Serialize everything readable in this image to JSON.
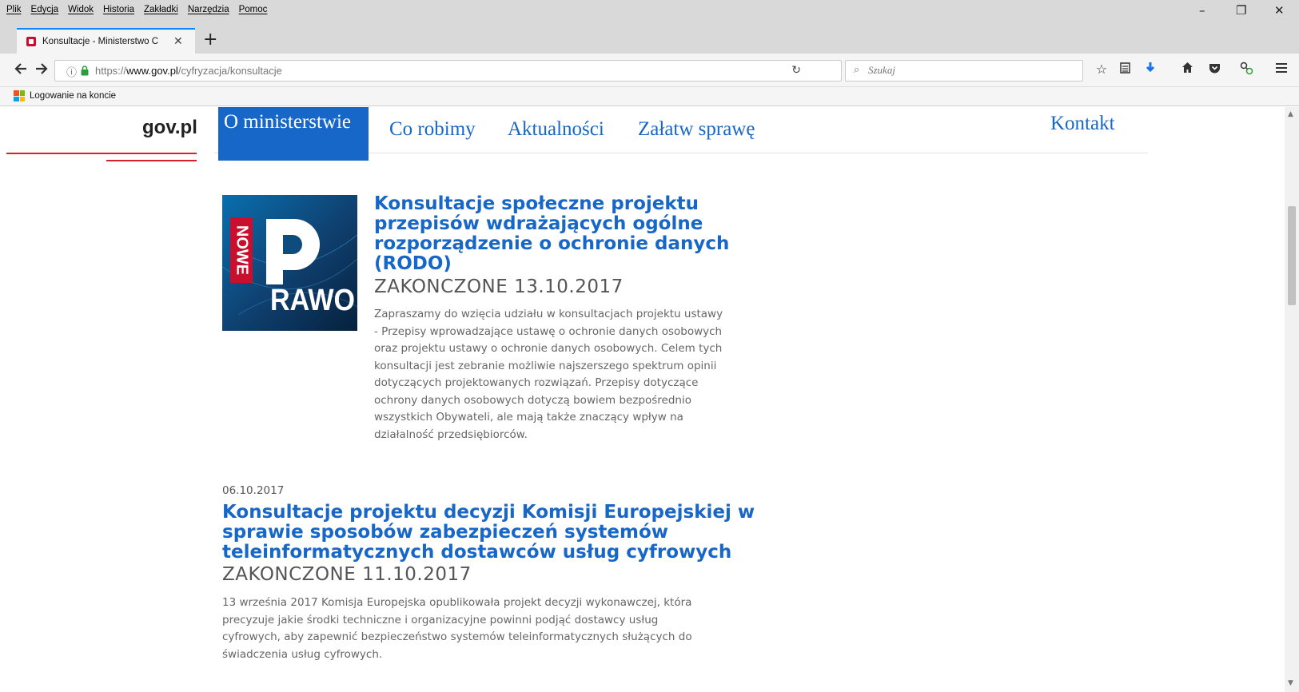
{
  "browser": {
    "menu": [
      "Plik",
      "Edycja",
      "Widok",
      "Historia",
      "Zakładki",
      "Narzędzia",
      "Pomoc"
    ],
    "window_controls": {
      "minimize": "–",
      "restore": "❐",
      "close": "✕"
    },
    "tab": {
      "title": "Konsultacje - Ministerstwo C",
      "close": "✕"
    },
    "new_tab": "+",
    "url": {
      "scheme": "https://",
      "host": "www.gov.pl",
      "path": "/cyfryzacja/konsultacje"
    },
    "search": {
      "placeholder": "Szukaj"
    },
    "bookmarks": [
      {
        "label": "Logowanie na koncie"
      }
    ]
  },
  "site": {
    "logo": "gov.pl",
    "nav": [
      {
        "label": "O ministerstwie",
        "active": true
      },
      {
        "label": "Co robimy"
      },
      {
        "label": "Aktualności"
      },
      {
        "label": "Załatw sprawę"
      },
      {
        "label": "Kontakt"
      }
    ]
  },
  "articles": [
    {
      "image": {
        "word_top": "NOWE",
        "word_bottom": "RAWO"
      },
      "title": [
        "Konsultacje społeczne projektu",
        "przepisów wdrażających ogólne",
        "rozporządzenie o ochronie danych",
        "(RODO)"
      ],
      "status": "ZAKONCZONE 13.10.2017",
      "description": [
        "Zapraszamy do wzięcia udziału w konsultacjach projektu ustawy",
        "- Przepisy wprowadzające ustawę o ochronie danych osobowych",
        "oraz projektu ustawy o ochronie danych osobowych. Celem tych",
        "konsultacji jest zebranie możliwie najszerszego spektrum opinii",
        "dotyczących projektowanych rozwiązań. Przepisy dotyczące",
        "ochrony danych osobowych dotyczą bowiem bezpośrednio",
        "wszystkich Obywateli, ale mają także znaczący wpływ na",
        "działalność przedsiębiorców."
      ]
    },
    {
      "date": "06.10.2017",
      "title": [
        "Konsultacje projektu decyzji Komisji Europejskiej w",
        "sprawie sposobów zabezpieczeń systemów",
        "teleinformatycznych dostawców usług cyfrowych"
      ],
      "status": "ZAKONCZONE 11.10.2017",
      "description": [
        "13 września 2017 Komisja Europejska opublikowała projekt decyzji wykonawczej, która",
        "precyzuje jakie środki techniczne i organizacyjne powinni podjąć dostawcy usług",
        "cyfrowych, aby zapewnić bezpieczeństwo systemów teleinformatycznych służących do",
        "świadczenia usług cyfrowych."
      ]
    }
  ],
  "colors": {
    "accent": "#1767c9",
    "brand_red": "#d5202f",
    "tab_highlight": "#0a84ff"
  },
  "icons": [
    "back-icon",
    "forward-icon",
    "info-icon",
    "lock-icon",
    "reload-icon",
    "search-icon",
    "star-icon",
    "reading-list-icon",
    "download-icon",
    "home-icon",
    "pocket-icon",
    "extension-icon",
    "hamburger-menu-icon"
  ]
}
